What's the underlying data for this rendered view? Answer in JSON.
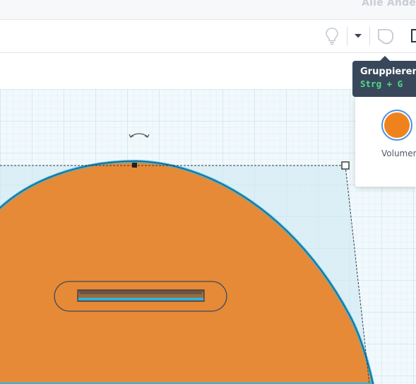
{
  "header": {
    "status_text": "Alle Ände"
  },
  "toolbar": {
    "icons": [
      "lightbulb-icon",
      "chevron-down-icon",
      "group-shape-icon"
    ]
  },
  "tooltip": {
    "title": "Gruppieren",
    "shortcut": "Strg + G"
  },
  "inspector": {
    "mode_label": "Volumen",
    "color": "#f0821e"
  },
  "scene": {
    "shape_color": "#e68a38",
    "selection_outline_color": "#29b6e6",
    "grid_color": "#d3ecf3",
    "workplane_color": "#eef8fb"
  }
}
